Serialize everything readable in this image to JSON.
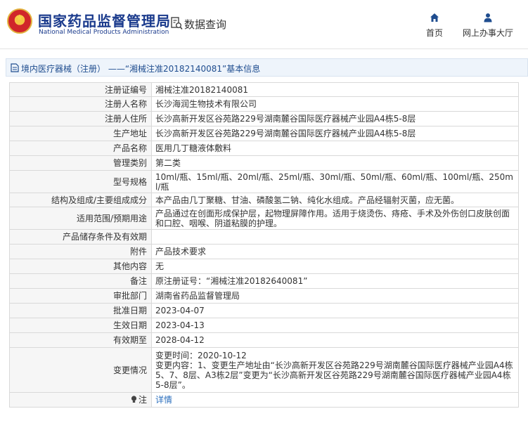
{
  "header": {
    "logo_cn": "国家药品监督管理局",
    "logo_en": "National Medical Products Administration",
    "query_label": "数据查询",
    "nav": [
      {
        "label": "首页",
        "icon": "home-icon"
      },
      {
        "label": "网上办事大厅",
        "icon": "user-icon"
      }
    ]
  },
  "breadcrumb": "境内医疗器械（注册） ——“湘械注准20182140081”基本信息",
  "rows": [
    {
      "label": "注册证编号",
      "value": "湘械注准20182140081"
    },
    {
      "label": "注册人名称",
      "value": "长沙海润生物技术有限公司"
    },
    {
      "label": "注册人住所",
      "value": "长沙高新开发区谷苑路229号湖南麓谷国际医疗器械产业园A4栋5-8层"
    },
    {
      "label": "生产地址",
      "value": "长沙高新开发区谷苑路229号湖南麓谷国际医疗器械产业园A4栋5-8层"
    },
    {
      "label": "产品名称",
      "value": "医用几丁糖液体敷料"
    },
    {
      "label": "管理类别",
      "value": "第二类"
    },
    {
      "label": "型号规格",
      "value": "10ml/瓶、15ml/瓶、20ml/瓶、25ml/瓶、30ml/瓶、50ml/瓶、60ml/瓶、100ml/瓶、250ml/瓶"
    },
    {
      "label": "结构及组成/主要组成成分",
      "value": "本产品由几丁聚糖、甘油、磷酸氢二钠、纯化水组成。产品经辐射灭菌，应无菌。"
    },
    {
      "label": "适用范围/预期用途",
      "value": "产品通过在创面形成保护层，起物理屏障作用。适用于烧烫伤、痔疮、手术及外伤创口皮肤创面和口腔、咽喉、阴道粘膜的护理。"
    },
    {
      "label": "产品储存条件及有效期",
      "value": ""
    },
    {
      "label": "附件",
      "value": "产品技术要求"
    },
    {
      "label": "其他内容",
      "value": "无"
    },
    {
      "label": "备注",
      "value": "原注册证号：“湘械注准20182640081”"
    },
    {
      "label": "审批部门",
      "value": "湖南省药品监督管理局"
    },
    {
      "label": "批准日期",
      "value": "2023-04-07"
    },
    {
      "label": "生效日期",
      "value": "2023-04-13"
    },
    {
      "label": "有效期至",
      "value": "2028-04-12"
    },
    {
      "label": "变更情况",
      "value": "变更时间：2020-10-12\n变更内容：1、变更生产地址由“长沙高新开发区谷苑路229号湖南麓谷国际医疗器械产业园A4栋5、7、8层、A3栋2层”变更为“长沙高新开发区谷苑路229号湖南麓谷国际医疗器械产业园A4栋5-8层”。"
    }
  ],
  "note": {
    "label": "注",
    "link": "详情",
    "icon": "lightbulb-icon"
  }
}
